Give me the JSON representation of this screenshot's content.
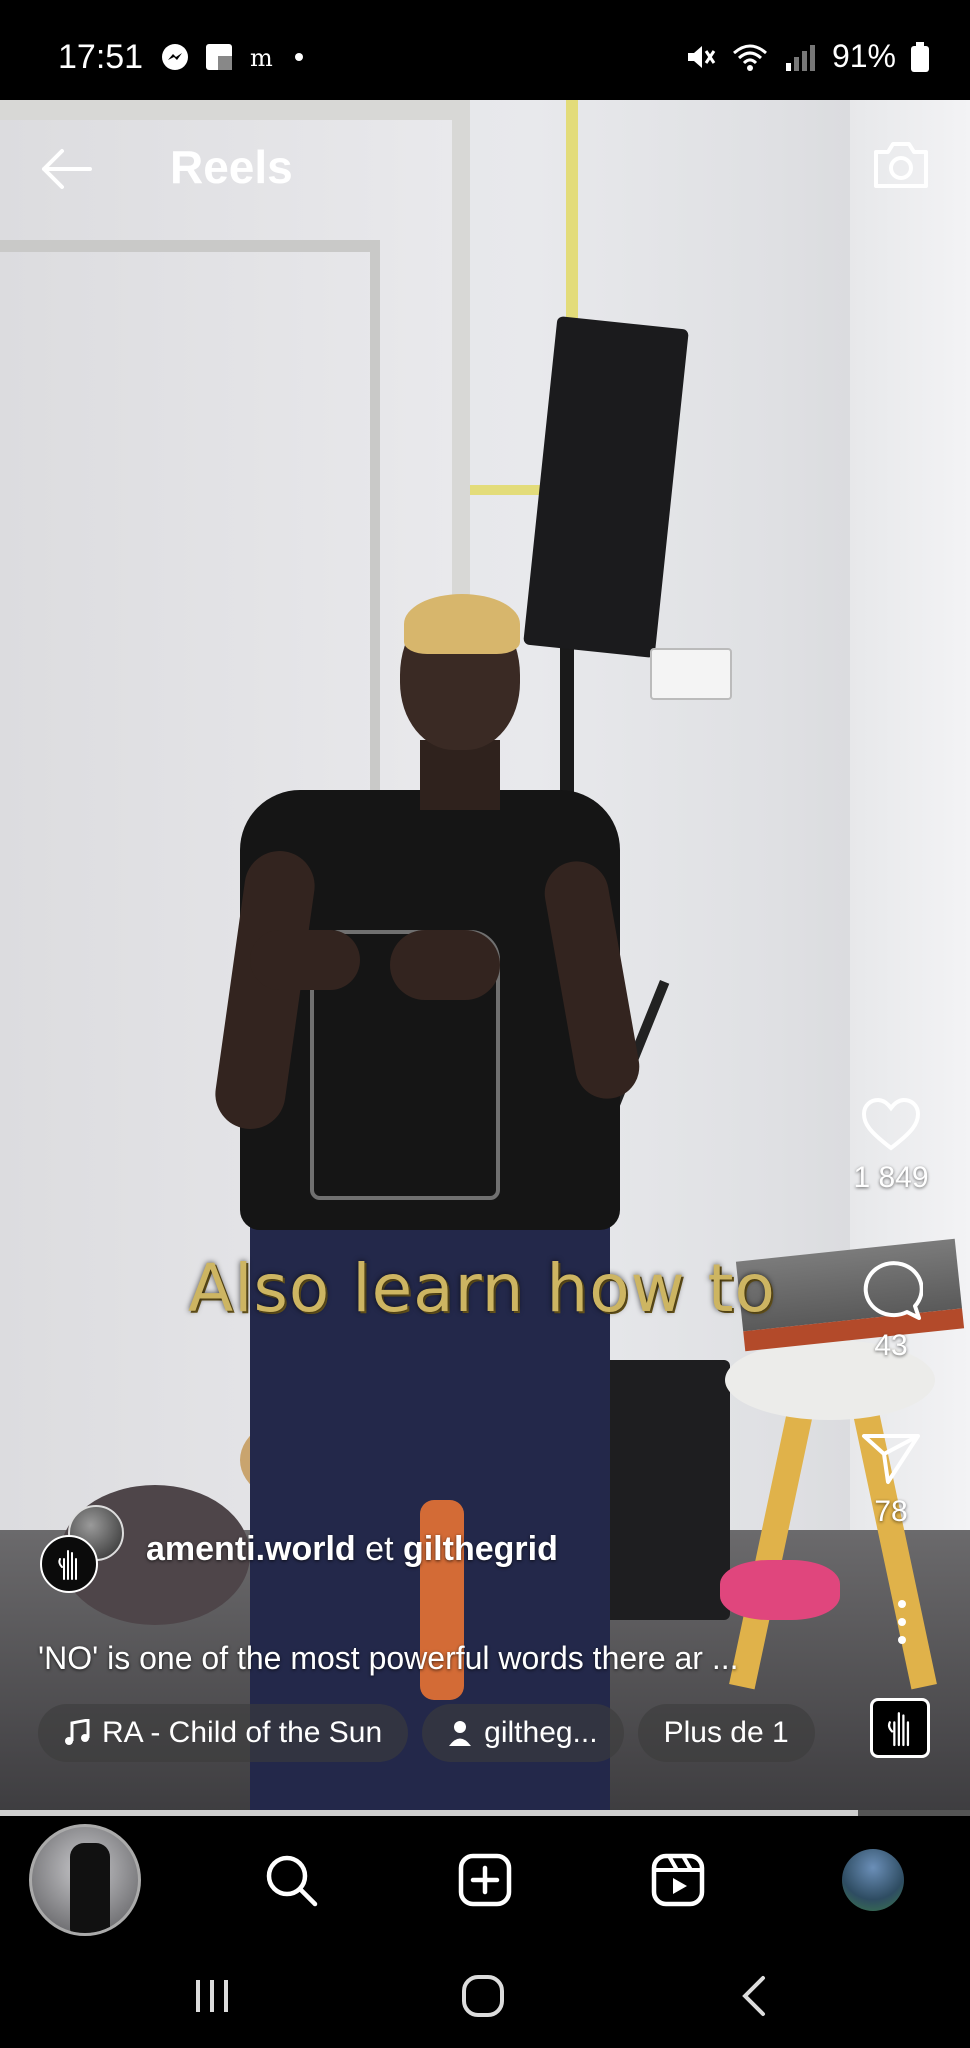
{
  "status_bar": {
    "time": "17:51",
    "left_icons": [
      "messenger-icon",
      "flipboard-icon",
      "lemonde-icon",
      "dot-icon"
    ],
    "right_icons": [
      "mute-icon",
      "wifi-icon",
      "signal-icon"
    ],
    "battery_percent": "91%"
  },
  "header": {
    "title": "Reels",
    "back_icon": "arrow-left-icon",
    "camera_icon": "camera-icon"
  },
  "video": {
    "overlay_caption": "Also learn how to"
  },
  "actions": {
    "like_count": "1 849",
    "comment_count": "43",
    "share_count": "78"
  },
  "post": {
    "author_1": "amenti.world",
    "connector": "et",
    "author_2": "gilthegrid",
    "caption": "'NO' is one of the most powerful words there ar ..."
  },
  "chips": {
    "music": "RA - Child of the Sun",
    "people": "giltheg...",
    "more": "Plus de 1"
  },
  "progress": {
    "fraction": 0.885
  },
  "bottom_nav": {
    "items": [
      "reel-thumbnail",
      "search-icon",
      "add-icon",
      "reels-icon",
      "profile-avatar"
    ]
  },
  "colors": {
    "caption_gold": "#cdb562",
    "background": "#000000"
  }
}
